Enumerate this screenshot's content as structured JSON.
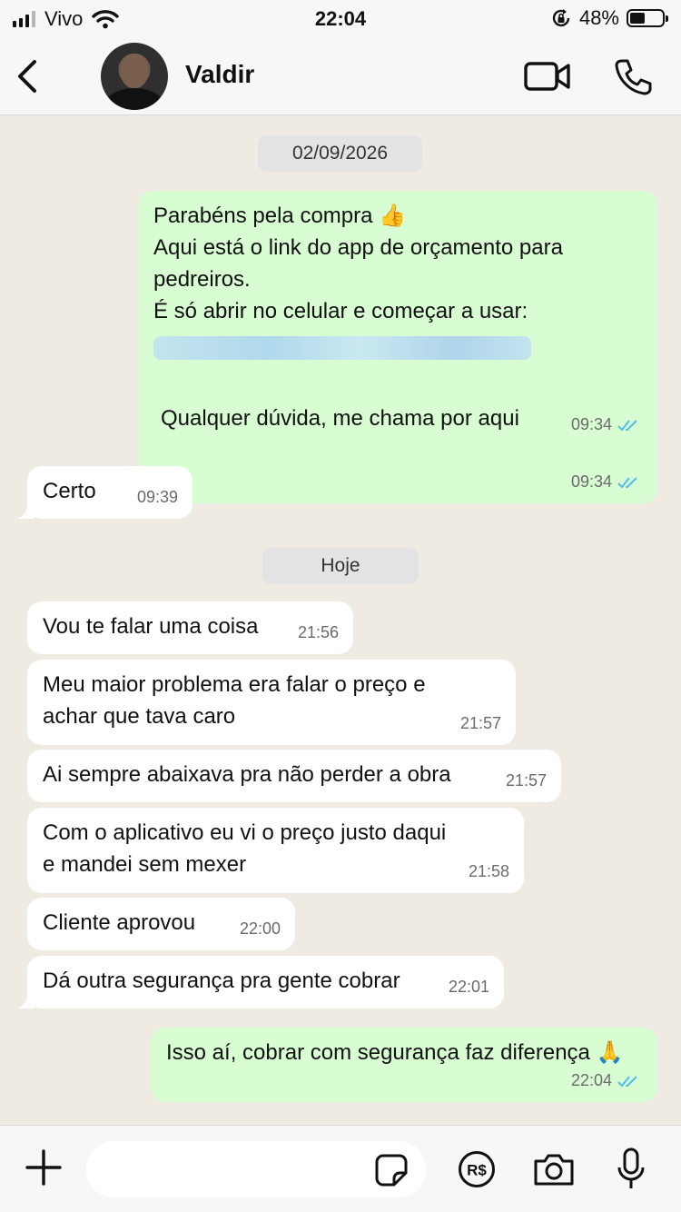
{
  "status_bar": {
    "carrier": "Vivo",
    "time": "22:04",
    "battery_percent": "48%",
    "battery_level": 0.48
  },
  "header": {
    "contact_name": "Valdir"
  },
  "chat": {
    "date_1": "02/09/2026",
    "date_2": "Hoje",
    "messages": [
      {
        "direction": "out",
        "text": "Parabéns pela compra 👍\nAqui está o link do app de orçamento para\npedreiros.\nÉ só abrir no celular e começar a usar:",
        "time": "09:34",
        "read": true
      },
      {
        "direction": "out",
        "text": "Qualquer dúvida, me chama por aqui",
        "time": "09:34",
        "read": true
      },
      {
        "direction": "in",
        "text": "Certo",
        "time": "09:39"
      },
      {
        "direction": "in",
        "text": "Vou te falar uma coisa",
        "time": "21:56"
      },
      {
        "direction": "in",
        "text": "Meu maior problema era falar o preço e\nachar que tava caro",
        "time": "21:57"
      },
      {
        "direction": "in",
        "text": "Ai sempre abaixava pra não perder a obra",
        "time": "21:57"
      },
      {
        "direction": "in",
        "text": "Com o aplicativo eu vi o preço justo daqui\ne mandei sem mexer",
        "time": "21:58"
      },
      {
        "direction": "in",
        "text": "Cliente aprovou",
        "time": "22:00"
      },
      {
        "direction": "in",
        "text": "Dá outra segurança pra gente cobrar",
        "time": "22:01"
      },
      {
        "direction": "out",
        "text": "Isso aí, cobrar com segurança faz diferença 🙏",
        "time": "22:04",
        "read": true
      }
    ]
  },
  "colors": {
    "outgoing_bubble": "#d9fdd3",
    "incoming_bubble": "#ffffff",
    "chat_background": "#efeae2",
    "read_ticks": "#53bdeb"
  },
  "icons": [
    "back-chevron-icon",
    "video-call-icon",
    "phone-icon",
    "plus-icon",
    "sticker-icon",
    "payment-real-icon",
    "camera-icon",
    "microphone-icon"
  ]
}
